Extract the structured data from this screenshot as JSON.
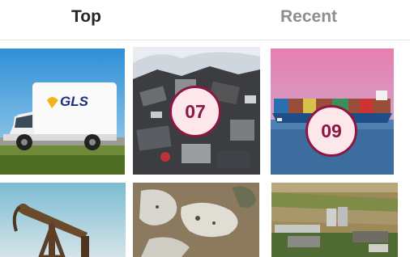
{
  "tabs": {
    "top": "Top",
    "recent": "Recent"
  },
  "tiles": [
    {
      "subject": "delivery-van",
      "van_text": "GLS"
    },
    {
      "subject": "electronic-waste",
      "badge": "07"
    },
    {
      "subject": "container-ship",
      "badge": "09"
    },
    {
      "subject": "oil-pump-jack"
    },
    {
      "subject": "aerial-flood-terrain"
    },
    {
      "subject": "aerial-farm-silos"
    }
  ],
  "colors": {
    "badge_border": "#8e1645",
    "badge_fill": "#fde7ea",
    "tab_active": "#262626",
    "tab_inactive": "#8e8e8e"
  }
}
